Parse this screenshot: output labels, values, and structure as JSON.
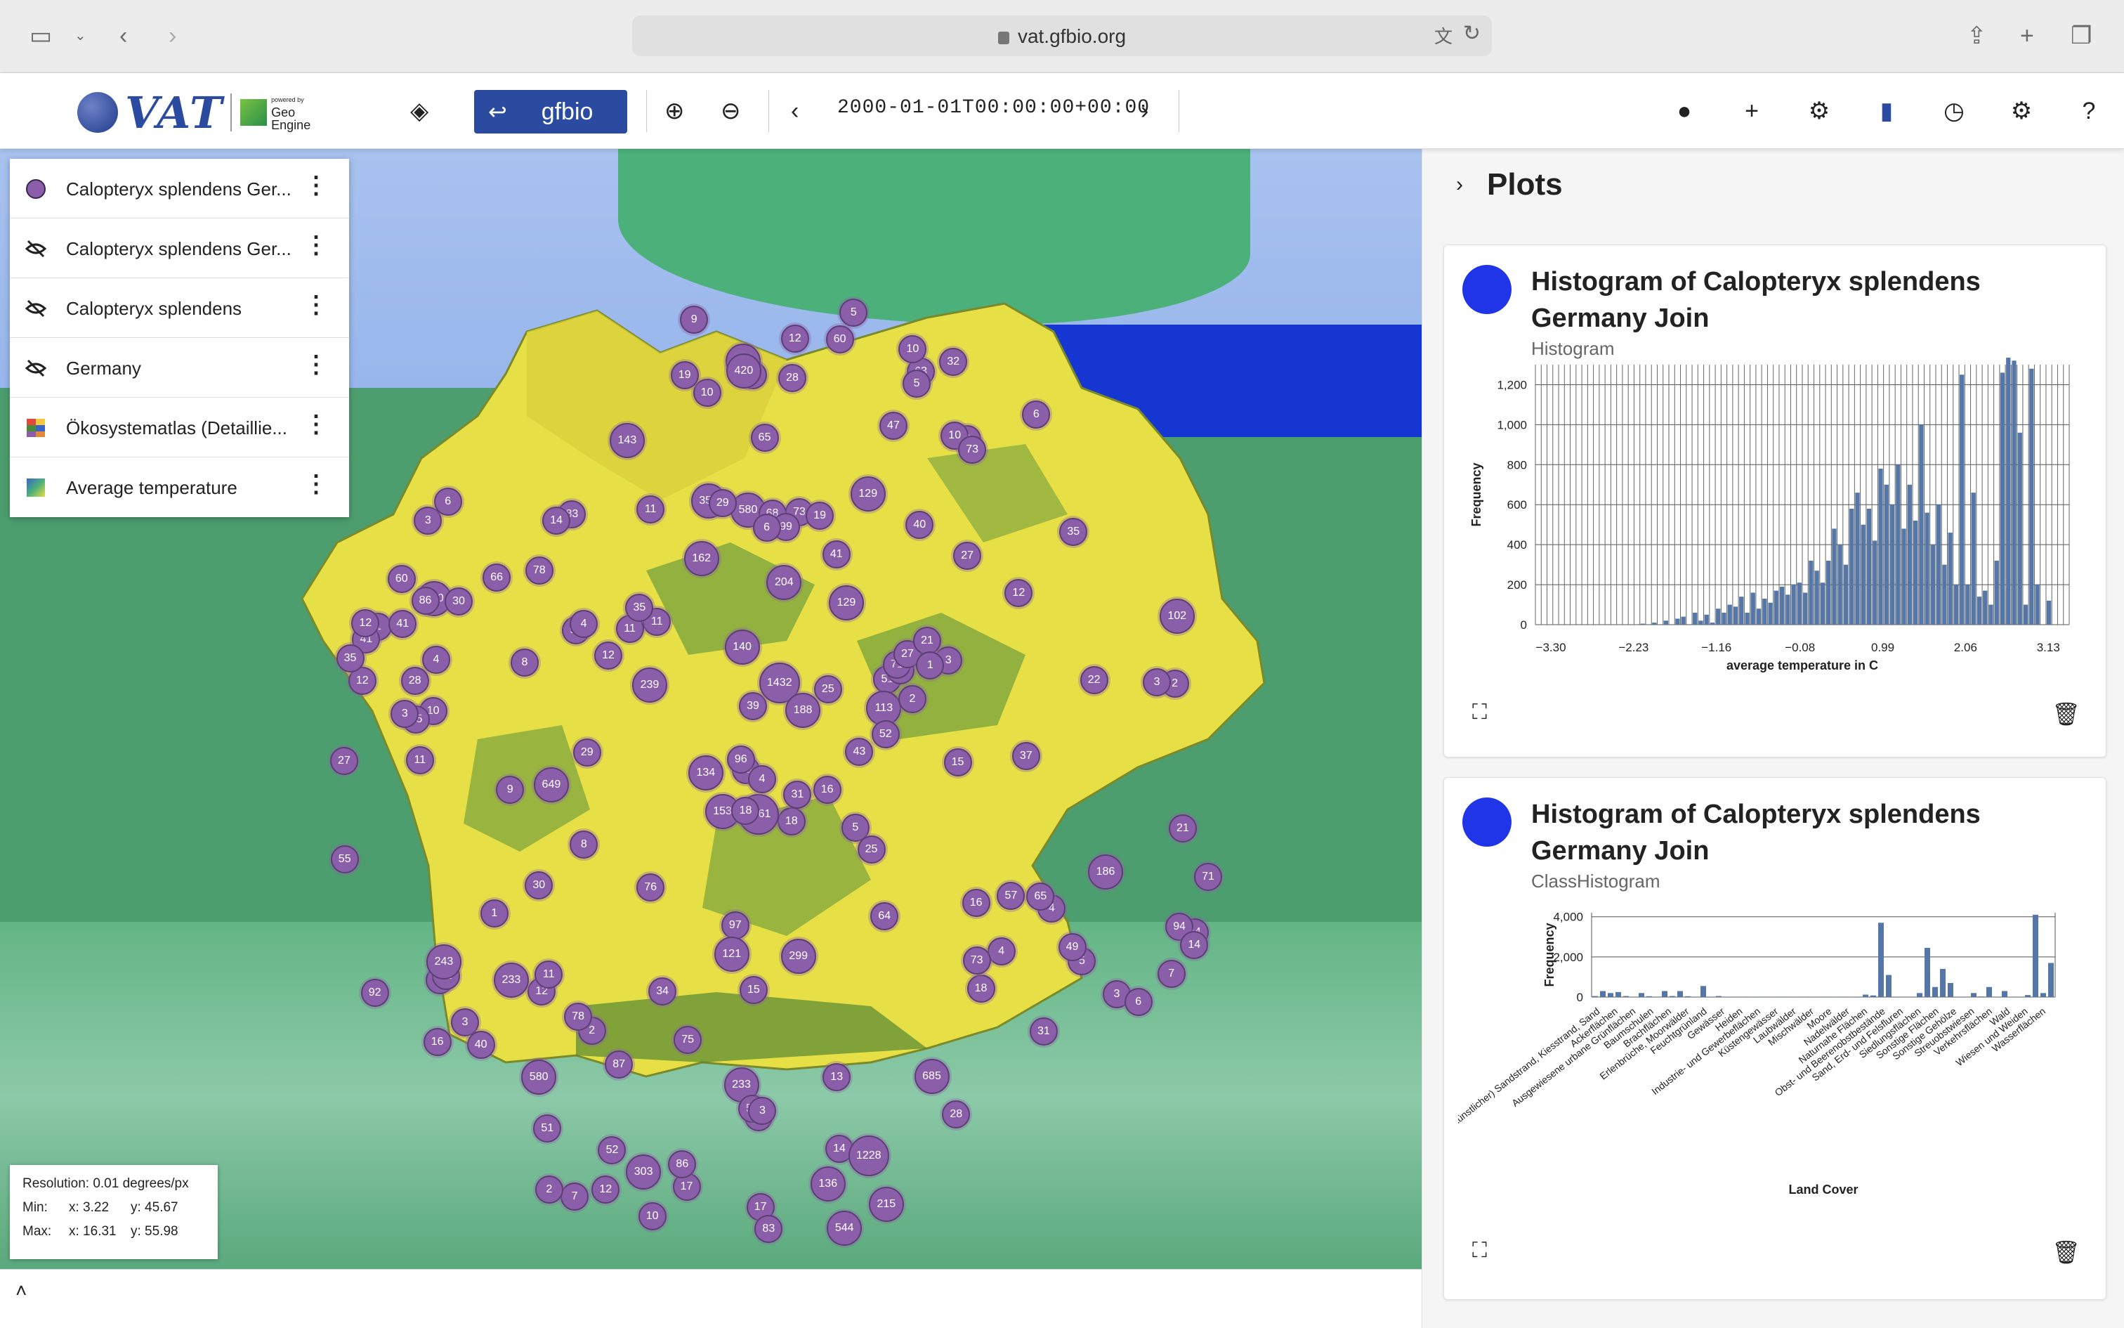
{
  "browser": {
    "url": "vat.gfbio.org"
  },
  "toolbar": {
    "logo_text": "VAT",
    "logo_powered": "powered by",
    "logo_geo": "Geo",
    "logo_engine": "Engine",
    "gfbio_label": "gfbio",
    "time": "2000-01-01T00:00:00+00:00"
  },
  "layers": [
    {
      "name": "Calopteryx splendens Ger...",
      "icon": "circle-icon"
    },
    {
      "name": "Calopteryx splendens Ger...",
      "icon": "visibility-off-icon"
    },
    {
      "name": "Calopteryx splendens",
      "icon": "visibility-off-icon"
    },
    {
      "name": "Germany",
      "icon": "visibility-off-icon"
    },
    {
      "name": "Ökosystematlas (Detaillie...",
      "icon": "raster-icon"
    },
    {
      "name": "Average temperature",
      "icon": "raster-icon"
    }
  ],
  "resolution": {
    "label": "Resolution: 0.01 degrees/px",
    "min_label": "Min:",
    "min_x": "x: 3.22",
    "min_y": "y: 45.67",
    "max_label": "Max:",
    "max_x": "x: 16.31",
    "max_y": "y: 55.98"
  },
  "panel": {
    "title": "Plots"
  },
  "plots": [
    {
      "title": "Histogram of Calopteryx splendens Germany Join",
      "subtitle": "Histogram"
    },
    {
      "title": "Histogram of Calopteryx splendens Germany Join",
      "subtitle": "ClassHistogram"
    }
  ],
  "chart_data": [
    {
      "type": "bar",
      "xlabel": "average temperature in C",
      "ylabel": "Frequency",
      "x_ticks": [
        "−3.30",
        "−2.23",
        "−1.16",
        "−0.08",
        "0.99",
        "2.06",
        "3.13"
      ],
      "y_ticks": [
        "0",
        "200",
        "400",
        "600",
        "800",
        "1,000",
        "1,200"
      ],
      "xlim": [
        -3.5,
        3.4
      ],
      "ylim": [
        0,
        1300
      ],
      "values": [
        0,
        0,
        0,
        0,
        0,
        0,
        0,
        0,
        0,
        0,
        0,
        0,
        0,
        0,
        0,
        0,
        0,
        0,
        5,
        0,
        10,
        0,
        20,
        0,
        30,
        40,
        0,
        60,
        20,
        50,
        10,
        80,
        60,
        100,
        90,
        140,
        60,
        160,
        80,
        130,
        110,
        170,
        190,
        150,
        200,
        210,
        160,
        320,
        270,
        210,
        320,
        480,
        400,
        300,
        580,
        660,
        500,
        580,
        420,
        780,
        700,
        600,
        800,
        480,
        700,
        520,
        1000,
        560,
        400,
        600,
        300,
        460,
        200,
        1250,
        200,
        660,
        140,
        170,
        100,
        320,
        1260,
        1480,
        1320,
        960,
        100,
        1280,
        200,
        0,
        120,
        0,
        0,
        0
      ]
    },
    {
      "type": "bar",
      "xlabel": "Land Cover",
      "ylabel": "Frequency",
      "y_ticks": [
        "0",
        "2,000",
        "4,000"
      ],
      "ylim": [
        0,
        4200
      ],
      "values": [
        50,
        300,
        200,
        250,
        50,
        20,
        200,
        40,
        20,
        300,
        50,
        300,
        40,
        20,
        550,
        20,
        50,
        20,
        10,
        10,
        10,
        20,
        10,
        10,
        20,
        10,
        10,
        10,
        10,
        10,
        20,
        10,
        20,
        10,
        20,
        120,
        80,
        3700,
        1100,
        20,
        10,
        20,
        200,
        2450,
        500,
        1400,
        700,
        20,
        20,
        200,
        30,
        500,
        20,
        300,
        10,
        20,
        100,
        4100,
        200,
        1700
      ],
      "x_tick_labels": [
        "(künstlicher) Sandstrand, Kiesstrand, Sand",
        "Ackerflächen",
        "Ausgewiesene urbane Grünflächen",
        "Baumschulen",
        "Brachflächen",
        "Erlenbrüche, Moorwälder",
        "Feuchtgrünland",
        "Gewässer",
        "Heiden",
        "Industrie- und Gewerbeflächen",
        "Küstengewässer",
        "Laubwälder",
        "Mischwälder",
        "Moore",
        "Nadelwälder",
        "Naturnahe Flächen",
        "Obst- und Beerenobstbestände",
        "Sand, Erd- und Felsfluren",
        "Siedlungsflächen",
        "Sonstige Flächen",
        "Sonstige Gehölze",
        "Streuobstwiesen",
        "Verkehrsflächen",
        "Wald",
        "Wiesen und Weiden",
        "Wasserflächen"
      ]
    }
  ]
}
